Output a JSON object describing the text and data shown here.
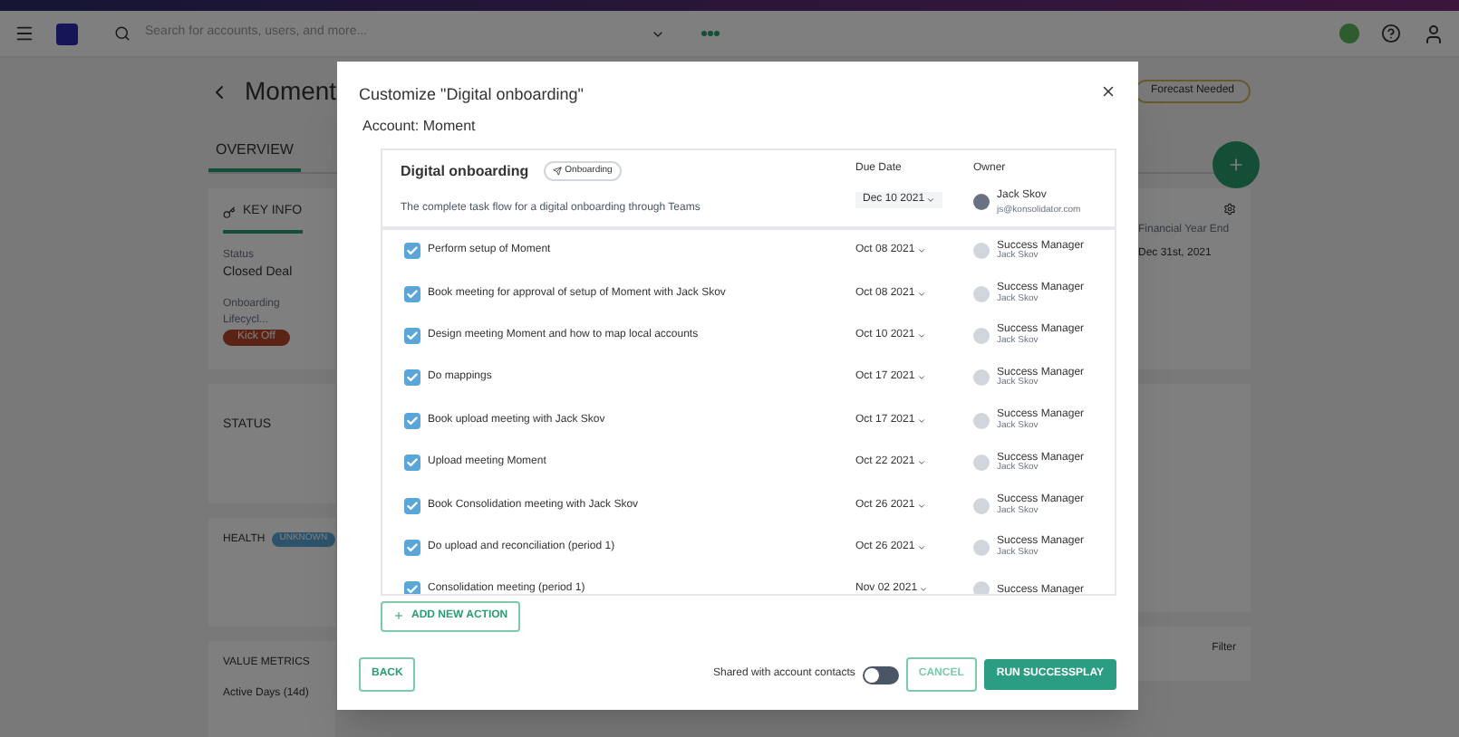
{
  "topbar": {
    "search_placeholder": "Search for accounts, users, and more..."
  },
  "account": {
    "name": "Moment",
    "badge": "Forecast Needed"
  },
  "tabs": [
    {
      "label": "OVERVIEW",
      "selected": true
    }
  ],
  "key_info": {
    "title": "KEY INFO",
    "fields": [
      {
        "label": "Status",
        "value": "Closed Deal"
      },
      {
        "label": "Onboarding Lifecycl...",
        "value": "Kick Off"
      }
    ],
    "right_field": {
      "label": "Financial Year End",
      "value": "Dec 31st, 2021"
    }
  },
  "status_panel": {
    "title": "STATUS"
  },
  "health_panel": {
    "title": "HEALTH",
    "badge": "UNKNOWN"
  },
  "value_metrics": {
    "title": "VALUE METRICS",
    "metric": "Active Days (14d)",
    "filter": "Filter"
  },
  "modal": {
    "title": "Customize \"Digital onboarding\"",
    "account_line": "Account: Moment",
    "play": {
      "name": "Digital onboarding",
      "tag": "Onboarding",
      "description": "The complete task flow for a digital onboarding through Teams",
      "due_label": "Due Date",
      "due": "Dec 10 2021",
      "owner_label": "Owner",
      "owner_name": "Jack Skov",
      "owner_email": "js@konsolidator.com"
    },
    "actions": [
      {
        "label": "Perform setup of Moment",
        "checked": true,
        "date": "Oct 08 2021",
        "role": "Success Manager",
        "person": "Jack Skov"
      },
      {
        "label": "Book meeting for approval of setup of Moment with Jack Skov",
        "checked": true,
        "date": "Oct 08 2021",
        "role": "Success Manager",
        "person": "Jack Skov"
      },
      {
        "label": "Design meeting Moment and how to map local accounts",
        "checked": true,
        "date": "Oct 10 2021",
        "role": "Success Manager",
        "person": "Jack Skov"
      },
      {
        "label": "Do mappings",
        "checked": true,
        "date": "Oct 17 2021",
        "role": "Success Manager",
        "person": "Jack Skov"
      },
      {
        "label": "Book upload meeting with Jack Skov",
        "checked": true,
        "date": "Oct 17 2021",
        "role": "Success Manager",
        "person": "Jack Skov"
      },
      {
        "label": "Upload meeting Moment",
        "checked": true,
        "date": "Oct 22 2021",
        "role": "Success Manager",
        "person": "Jack Skov"
      },
      {
        "label": "Book Consolidation meeting with Jack Skov",
        "checked": true,
        "date": "Oct 26 2021",
        "role": "Success Manager",
        "person": "Jack Skov"
      },
      {
        "label": "Do upload and reconciliation (period 1)",
        "checked": true,
        "date": "Oct 26 2021",
        "role": "Success Manager",
        "person": "Jack Skov"
      },
      {
        "label": "Consolidation meeting (period 1)",
        "checked": true,
        "date": "Nov 02 2021",
        "role": "Success Manager"
      }
    ],
    "add_action": "ADD NEW ACTION",
    "back": "BACK",
    "share_label": "Shared with account contacts",
    "share_on": false,
    "cancel": "CANCEL",
    "run": "RUN SUCCESSPLAY"
  }
}
